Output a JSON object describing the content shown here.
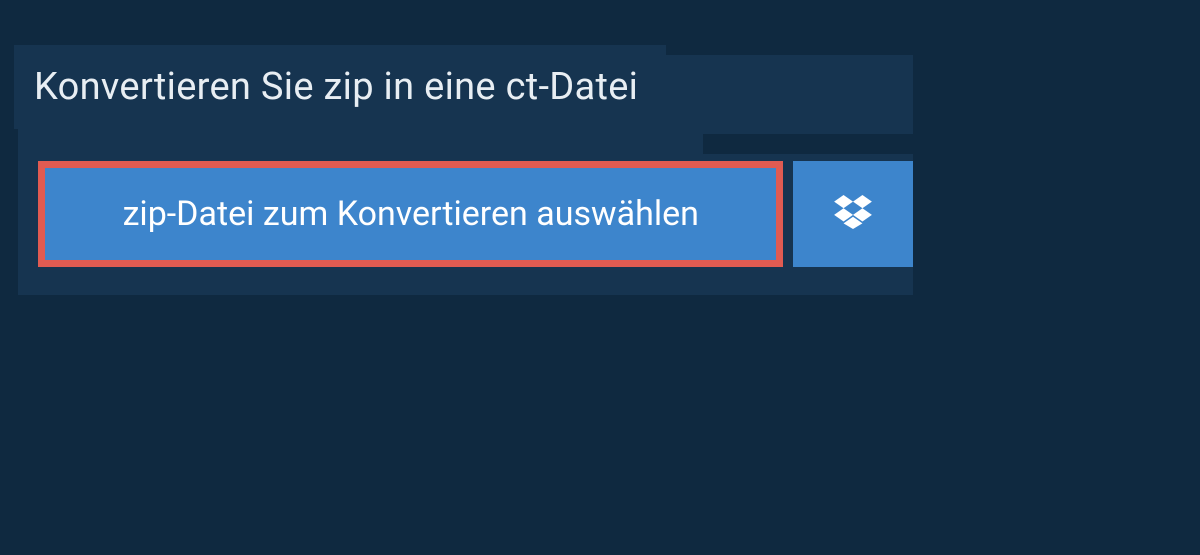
{
  "title": "Konvertieren Sie zip in eine ct-Datei",
  "buttons": {
    "select_file": "zip-Datei zum Konvertieren auswählen"
  }
}
